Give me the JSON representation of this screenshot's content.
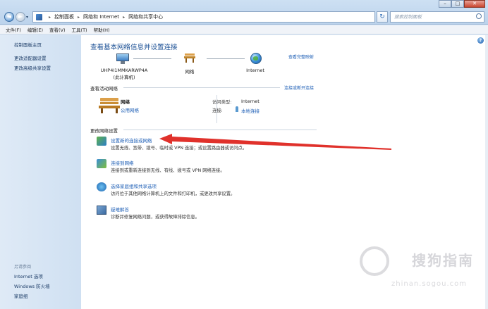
{
  "window": {
    "nav_back": "◄",
    "nav_forward": "►",
    "breadcrumbs": [
      "控制面板",
      "网络和 Internet",
      "网络和共享中心"
    ],
    "search_placeholder": "搜索控制面板",
    "minimize": "–",
    "maximize": "□",
    "close": "✕",
    "refresh": "↻"
  },
  "menu": [
    "文件(F)",
    "编辑(E)",
    "查看(V)",
    "工具(T)",
    "帮助(H)"
  ],
  "left_pane": {
    "links": [
      "控制面板主页",
      "更改适配器设置",
      "更改高级共享设置"
    ],
    "see_also_title": "另请参阅",
    "see_also": [
      "Internet 选项",
      "Windows 防火墙",
      "家庭组"
    ]
  },
  "main": {
    "title": "查看基本网络信息并设置连接",
    "view_full_map": "查看完整映射",
    "nodes": {
      "computer_name": "UHP4I1MMKARWP4A",
      "computer_sub": "(此计算机)",
      "network": "网络",
      "internet": "Internet"
    },
    "active_networks": {
      "heading": "查看活动网络",
      "connect_link": "连接或断开连接",
      "name": "网络",
      "type": "公用网络",
      "access_type_label": "访问类型:",
      "access_type_value": "Internet",
      "connection_label": "连接:",
      "connection_value": "本地连接"
    },
    "change_settings": {
      "heading": "更改网络设置",
      "tasks": [
        {
          "title": "设置新的连接或网络",
          "desc": "设置无线、宽带、拨号、临时或 VPN 连接；或设置路由器或访问点。",
          "icon": "setup-connection-icon"
        },
        {
          "title": "连接到网络",
          "desc": "连接到或重新连接到无线、有线、拨号或 VPN 网络连接。",
          "icon": "connect-network-icon"
        },
        {
          "title": "选择家庭组和共享选项",
          "desc": "访问位于其他网络计算机上的文件和打印机，或更改共享设置。",
          "icon": "homegroup-icon"
        },
        {
          "title": "疑难解答",
          "desc": "诊断并修复网络问题，或获得故障排除信息。",
          "icon": "troubleshoot-icon"
        }
      ]
    }
  },
  "watermark": {
    "text": "搜狗指南",
    "url": "zhinan.sogou.com"
  },
  "colors": {
    "link": "#1e5fb6",
    "title": "#1a4f94",
    "arrow": "#e0312b",
    "left_pane": "#d7e6f5"
  }
}
